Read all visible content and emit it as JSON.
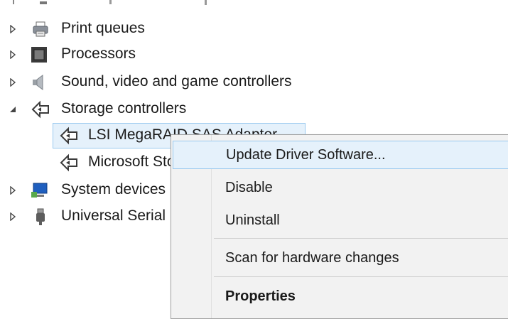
{
  "tree": {
    "items": [
      {
        "label": "Print queues",
        "expanded": false,
        "icon": "printer-icon"
      },
      {
        "label": "Processors",
        "expanded": false,
        "icon": "processor-icon"
      },
      {
        "label": "Sound, video and game controllers",
        "expanded": false,
        "icon": "speaker-icon"
      },
      {
        "label": "Storage controllers",
        "expanded": true,
        "icon": "storage-controller-icon",
        "children": [
          {
            "label": "LSI MegaRAID SAS Adapter",
            "icon": "storage-controller-icon",
            "selected": true
          },
          {
            "label": "Microsoft Storage Spaces Controller",
            "icon": "storage-controller-icon"
          }
        ]
      },
      {
        "label": "System devices",
        "expanded": false,
        "icon": "system-device-icon"
      },
      {
        "label": "Universal Serial Bus controllers",
        "expanded": false,
        "icon": "usb-icon"
      }
    ]
  },
  "context_menu": {
    "items": [
      {
        "label": "Update Driver Software...",
        "hover": true
      },
      {
        "label": "Disable"
      },
      {
        "label": "Uninstall"
      },
      {
        "label": "Scan for hardware changes"
      },
      {
        "label": "Properties",
        "bold": true
      }
    ]
  },
  "colors": {
    "selection_bg": "#e5f1fb",
    "selection_border": "#99c9ef",
    "menu_bg": "#f2f2f2"
  }
}
